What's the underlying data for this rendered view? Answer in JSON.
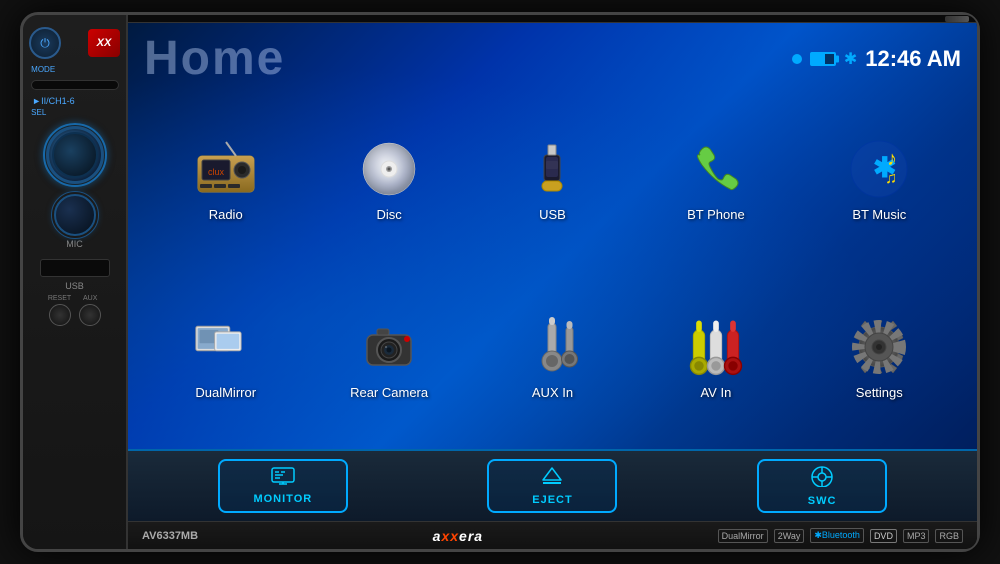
{
  "unit": {
    "model": "AV6337MB",
    "brand_text": "axxera",
    "brand_prefix": "a",
    "brand_xx": "xx",
    "brand_suffix": "era"
  },
  "header": {
    "title": "Home",
    "clock": "12:46 AM",
    "status_dot_color": "#00aaff",
    "bt_symbol": "✱"
  },
  "left_panel": {
    "power_label": "⏻",
    "xx_label": "XX",
    "mode_label": "MODE",
    "track_label": "►II/CH1-6",
    "sel_label": "SEL",
    "mic_label": "MIC",
    "usb_label": "USB",
    "reset_label": "RESET",
    "aux_label": "AUX"
  },
  "apps": [
    {
      "id": "radio",
      "label": "Radio",
      "row": 1
    },
    {
      "id": "disc",
      "label": "Disc",
      "row": 1
    },
    {
      "id": "usb",
      "label": "USB",
      "row": 1
    },
    {
      "id": "btphone",
      "label": "BT Phone",
      "row": 1
    },
    {
      "id": "btmusic",
      "label": "BT Music",
      "row": 1
    },
    {
      "id": "dualmirror",
      "label": "DualMirror",
      "row": 2
    },
    {
      "id": "rearcamera",
      "label": "Rear Camera",
      "row": 2
    },
    {
      "id": "auxin",
      "label": "AUX In",
      "row": 2
    },
    {
      "id": "avin",
      "label": "AV In",
      "row": 2
    },
    {
      "id": "settings",
      "label": "Settings",
      "row": 2
    }
  ],
  "bottom_buttons": [
    {
      "id": "monitor",
      "label": "MONITOR"
    },
    {
      "id": "eject",
      "label": "EJECT"
    },
    {
      "id": "swc",
      "label": "SWC"
    }
  ],
  "footer": {
    "model": "AV6337MB",
    "brand_display": "axxera",
    "badges": [
      "DualMirror",
      "2Way",
      "Bluetooth",
      "DVD",
      "MP3",
      "RGB"
    ]
  }
}
